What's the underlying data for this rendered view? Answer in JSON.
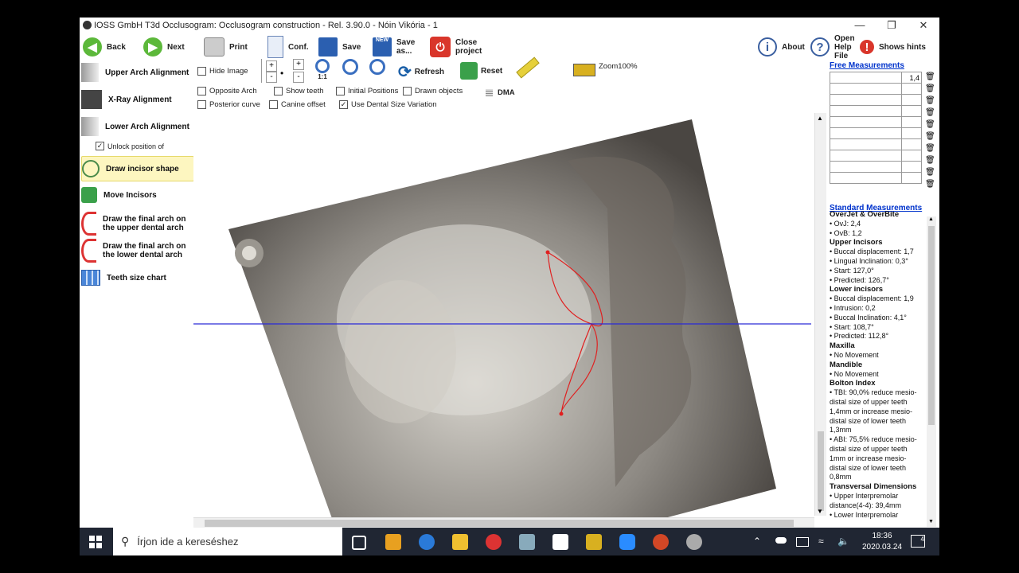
{
  "window": {
    "title": "IOSS GmbH T3d Occlusogram: Occlusogram construction - Rel. 3.90.0 - Nóin Vikória - 1"
  },
  "toolbar": {
    "back": "Back",
    "next": "Next",
    "print": "Print",
    "conf": "Conf.",
    "save": "Save",
    "save_as": "Save as...",
    "close_project": "Close project",
    "about": "About",
    "open_help": "Open Help File",
    "shows_hints": "Shows hints"
  },
  "left_panel": {
    "items": [
      {
        "label": "Upper Arch Alignment"
      },
      {
        "label": "X-Ray Alignment"
      },
      {
        "label": "Lower Arch Alignment"
      },
      {
        "label": "Draw incisor shape"
      },
      {
        "label": "Move Incisors"
      },
      {
        "label": "Draw the final arch on the upper dental arch"
      },
      {
        "label": "Draw the final arch on the lower dental arch"
      },
      {
        "label": "Teeth size chart"
      }
    ],
    "unlock_label": "Unlock position of",
    "unlock_checked": true
  },
  "options": {
    "hide_image": "Hide Image",
    "opposite_arch": "Opposite Arch",
    "show_teeth": "Show teeth",
    "initial_positions": "Initial Positions",
    "drawn_objects": "Drawn objects",
    "posterior_curve": "Posterior curve",
    "canine_offset": "Canine offset",
    "use_dental_size": "Use Dental Size Variation",
    "use_dental_size_checked": true,
    "dma": "DMA",
    "refresh": "Refresh",
    "reset": "Reset",
    "zoom": "Zoom100%",
    "zoom_1to1": "1:1"
  },
  "free_measurements": {
    "title": "Free Measurements",
    "rows": [
      "1,4",
      "",
      "",
      "",
      "",
      "",
      "",
      "",
      "",
      ""
    ]
  },
  "standard_measurements": {
    "title": "Standard Measurements",
    "lines": [
      {
        "t": "OverJet & OverBite",
        "h": true
      },
      {
        "t": "• OvJ: 2,4"
      },
      {
        "t": "• OvB: 1,2"
      },
      {
        "t": "Upper Incisors",
        "h": true
      },
      {
        "t": "• Buccal displacement: 1,7"
      },
      {
        "t": "• Lingual Inclination: 0,3°"
      },
      {
        "t": "• Start: 127,0°"
      },
      {
        "t": "• Predicted: 126,7°"
      },
      {
        "t": "Lower incisors",
        "h": true
      },
      {
        "t": "• Buccal displacement: 1,9"
      },
      {
        "t": "• Intrusion: 0,2"
      },
      {
        "t": "• Buccal Inclination: 4,1°"
      },
      {
        "t": "• Start: 108,7°"
      },
      {
        "t": "• Predicted: 112,8°"
      },
      {
        "t": "Maxilla",
        "h": true
      },
      {
        "t": "• No Movement"
      },
      {
        "t": "Mandible",
        "h": true
      },
      {
        "t": "• No Movement"
      },
      {
        "t": "Bolton Index",
        "h": true
      },
      {
        "t": "• TBI: 90,0% reduce mesio-"
      },
      {
        "t": "distal size of upper teeth"
      },
      {
        "t": "1,4mm or increase mesio-"
      },
      {
        "t": "distal size of lower teeth"
      },
      {
        "t": "1,3mm"
      },
      {
        "t": "• ABI: 75,5% reduce mesio-"
      },
      {
        "t": "distal size of upper teeth"
      },
      {
        "t": "1mm or increase mesio-"
      },
      {
        "t": "distal size of lower teeth"
      },
      {
        "t": "0,8mm"
      },
      {
        "t": "Transversal Dimensions",
        "h": true
      },
      {
        "t": "• Upper  Interpremolar"
      },
      {
        "t": "distance(4-4): 39,4mm"
      },
      {
        "t": "• Lower  Interpremolar"
      }
    ]
  },
  "taskbar": {
    "search_placeholder": "Írjon ide a kereséshez",
    "time": "18:36",
    "date": "2020.03.24",
    "notifications": "4"
  }
}
